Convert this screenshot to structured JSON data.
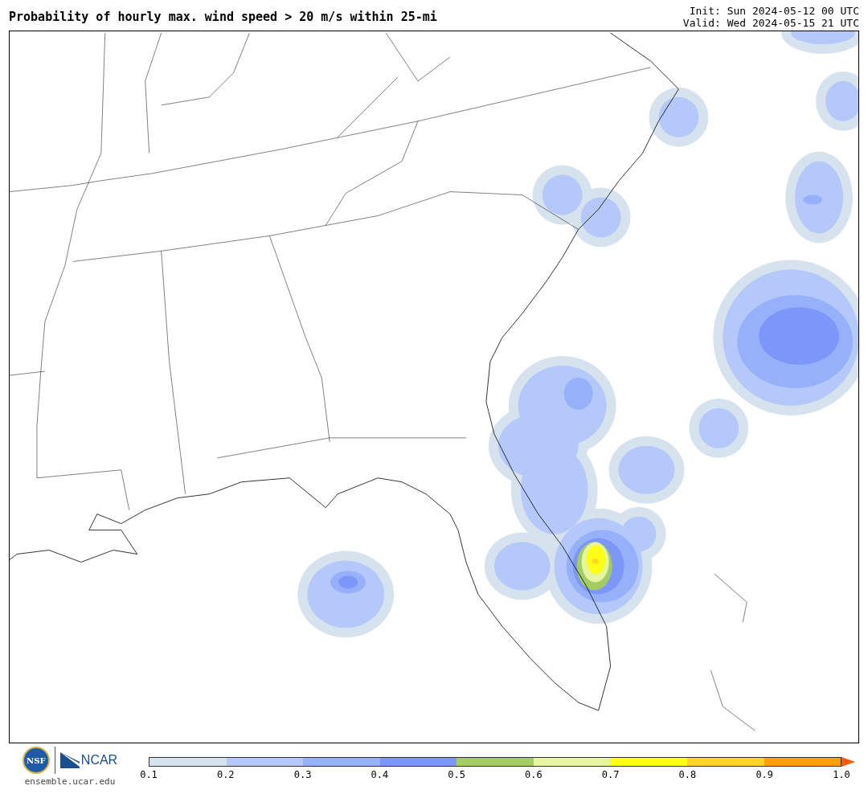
{
  "header": {
    "title": "Probability of hourly max. wind speed > 20 m/s within 25-mi",
    "init": "Init: Sun 2024-05-12 00 UTC",
    "valid": "Valid: Wed 2024-05-15 21 UTC"
  },
  "footer": {
    "nsf_logo": "NSF",
    "ncar_logo": "NCAR",
    "site": "ensemble.ucar.edu"
  },
  "colorbar": {
    "bins": [
      {
        "kind": "segment",
        "color": "#d6e2ee"
      },
      {
        "kind": "segment",
        "color": "#b4c8fa"
      },
      {
        "kind": "segment",
        "color": "#96b0fa"
      },
      {
        "kind": "segment",
        "color": "#7d96fa"
      },
      {
        "kind": "segment",
        "color": "#a4cc64"
      },
      {
        "kind": "segment",
        "color": "#e6f5a0"
      },
      {
        "kind": "segment",
        "color": "#ffff14"
      },
      {
        "kind": "segment",
        "color": "#ffd228"
      },
      {
        "kind": "segment",
        "color": "#ffa00a"
      },
      {
        "kind": "arrow",
        "color": "#ff5a0a"
      }
    ],
    "ticks": [
      "0.1",
      "0.2",
      "0.3",
      "0.4",
      "0.5",
      "0.6",
      "0.7",
      "0.8",
      "0.9",
      "1.0"
    ]
  }
}
